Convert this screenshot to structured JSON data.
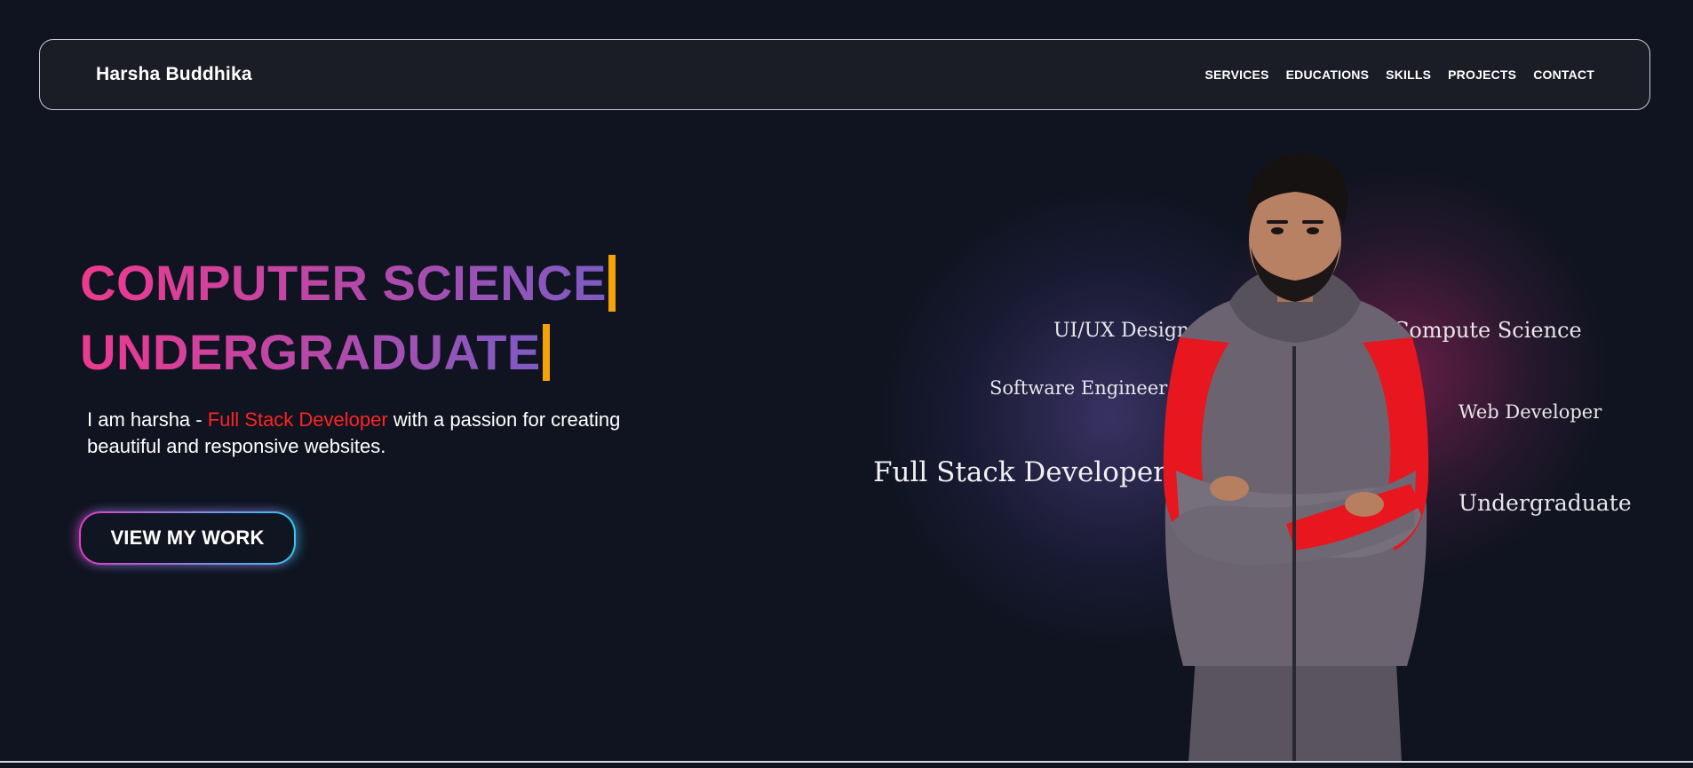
{
  "navbar": {
    "brand": "Harsha Buddhika",
    "links": [
      "SERVICES",
      "EDUCATIONS",
      "SKILLS",
      "PROJECTS",
      "CONTACT"
    ]
  },
  "hero": {
    "headline_line1": "COMPUTER SCIENCE",
    "headline_line2": "UNDERGRADUATE",
    "intro_prefix": "I am harsha - ",
    "intro_role": "Full Stack Developer",
    "intro_suffix": " with a passion for creating beautiful and responsive websites.",
    "cta_label": "VIEW MY WORK"
  },
  "visual": {
    "tags": {
      "uiux": "UI/UX Designer",
      "software": "Software Engineer",
      "fullstack": "Full Stack Developer",
      "compsci": "Compute Science",
      "webdev": "Web Developer",
      "undergrad": "Undergraduate"
    }
  },
  "colors": {
    "background": "#0f1420",
    "navbar_bg": "#1a1d26",
    "gradient_start": "#ee3a8e",
    "gradient_end": "#7e5bc2",
    "caret": "#f5a108",
    "role_highlight": "#ff2323",
    "cta_border_start": "#e23bc6",
    "cta_border_end": "#2fc9f4"
  },
  "icons": {
    "portrait": "person-portrait"
  }
}
